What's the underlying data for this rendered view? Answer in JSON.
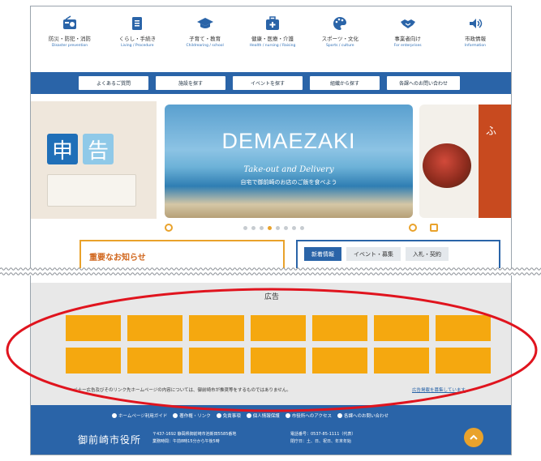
{
  "categories": [
    {
      "jp": "防災・防犯・消防",
      "en": "Disaster prevention",
      "icon": "radio-icon"
    },
    {
      "jp": "くらし・手続き",
      "en": "Living / Procedure",
      "icon": "document-icon"
    },
    {
      "jp": "子育て・教育",
      "en": "Childrearing / school",
      "icon": "graduation-cap-icon"
    },
    {
      "jp": "健康・医療・介護",
      "en": "Health / nursing / Raising",
      "icon": "medical-kit-icon"
    },
    {
      "jp": "スポーツ・文化",
      "en": "Sports / culture",
      "icon": "palette-icon"
    },
    {
      "jp": "事業者向け",
      "en": "For enterprises",
      "icon": "handshake-icon"
    },
    {
      "jp": "市政情報",
      "en": "Information",
      "icon": "speaker-icon"
    }
  ],
  "quick_links": [
    "よくあるご質問",
    "施設を探す",
    "イベントを探す",
    "組織から探す",
    "各課へのお問い合わせ"
  ],
  "carousel": {
    "left_chars": [
      "申",
      "告"
    ],
    "main_title": "DEMAEZAKI",
    "main_sub": "Take-out and Delivery",
    "main_sub2": "自宅で御前崎のお店のご飯を食べよう",
    "right_char": "ふ",
    "dot_count": 8,
    "active_dot": 3
  },
  "notice_title": "重要なお知らせ",
  "news_tabs": [
    "新着情報",
    "イベント・募集",
    "入札・契約"
  ],
  "ad": {
    "title": "広告",
    "tile_count": 14,
    "tile_color": "#f5a80f",
    "note": "バナー広告及びそのリンク先ホームページの内容については、御前崎市が推奨等をするものではありません。",
    "link": "広告掲載を募集しています"
  },
  "footer": {
    "links": [
      "ホームページ利用ガイド",
      "著作権・リンク",
      "免責事項",
      "個人情報保護",
      "市役所へのアクセス",
      "各課へのお問い合わせ"
    ],
    "office": "御前崎市役所",
    "address": "〒437-1692 静岡県御前崎市池新田5585番地",
    "hours": "業務時間：午前8時15分から午後5時",
    "tel": "電話番号：0537-85-1111（代表）",
    "closed": "閉庁日：土、日、祝日、年末年始"
  },
  "colors": {
    "primary": "#2a64a8",
    "accent": "#e9a22b",
    "annotation": "#e0141e"
  }
}
